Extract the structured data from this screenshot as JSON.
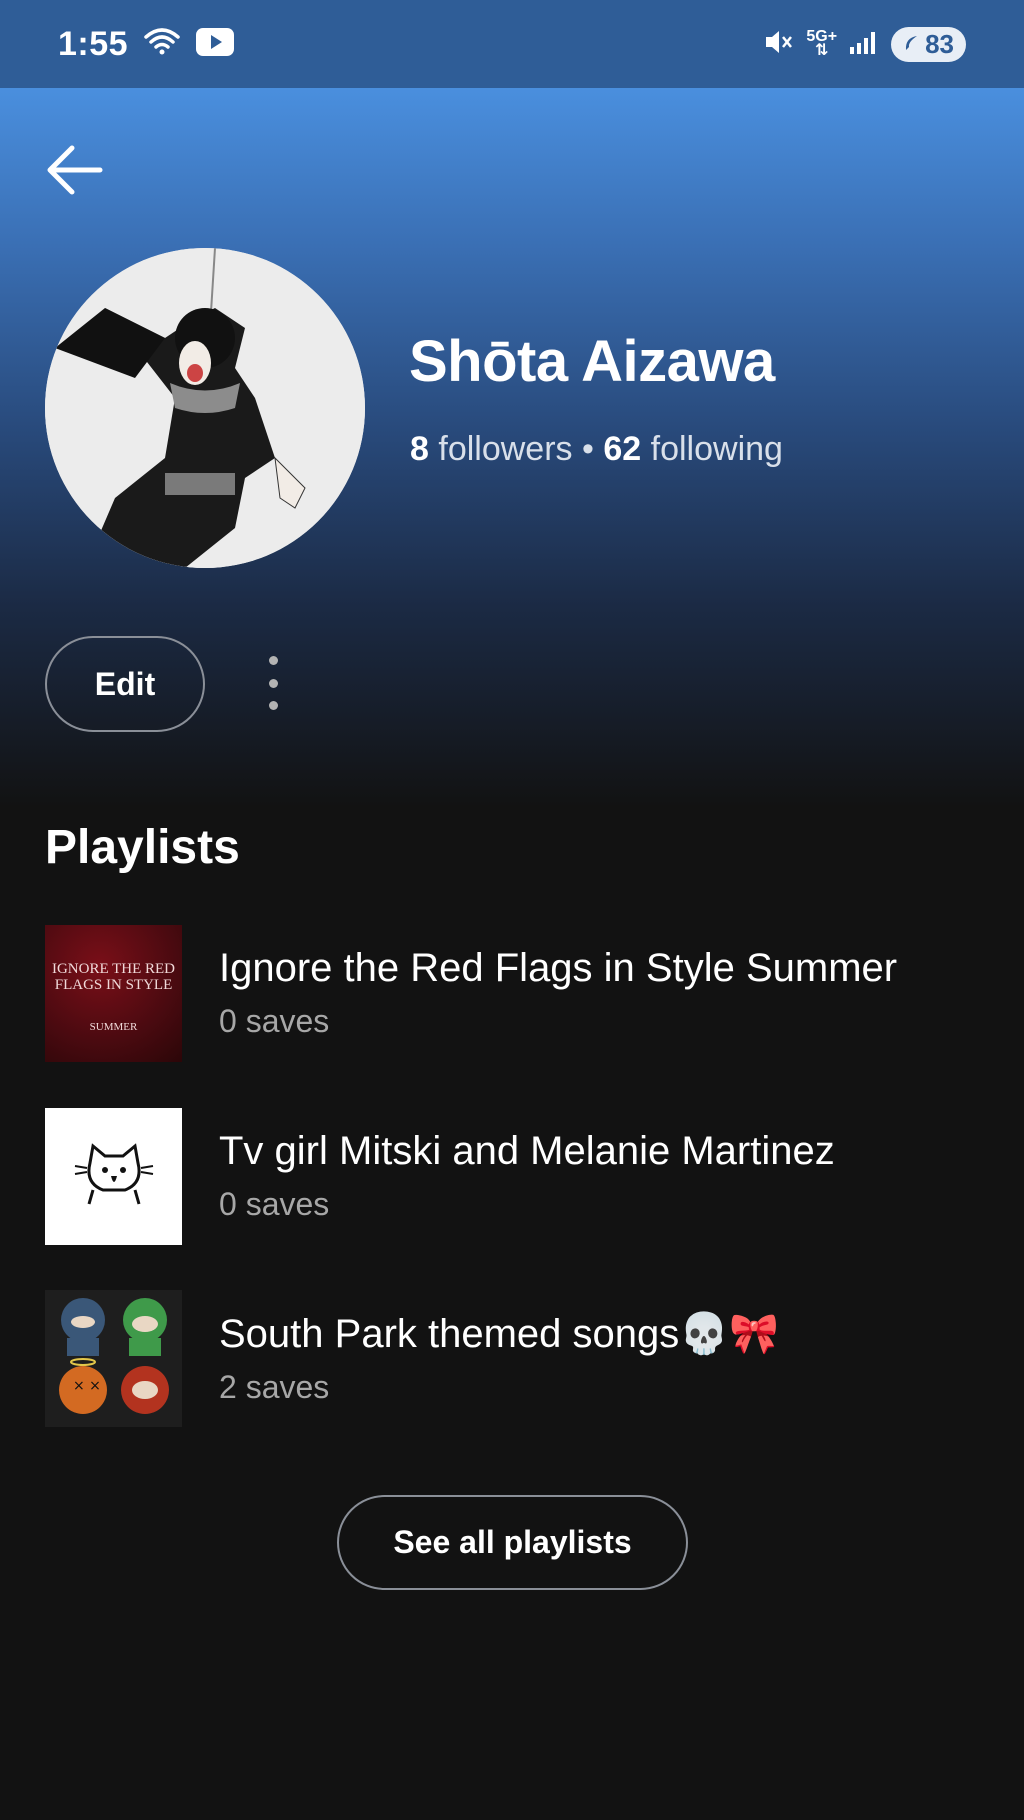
{
  "status_bar": {
    "time": "1:55",
    "network": "5G",
    "network_plus": "+",
    "battery": "83",
    "icons": [
      "wifi-icon",
      "youtube-icon",
      "mute-icon",
      "network-5g-icon",
      "signal-icon",
      "battery-icon"
    ]
  },
  "header": {
    "back_icon": "arrow-left-icon"
  },
  "profile": {
    "name": "Shōta Aizawa",
    "followers_count": "8",
    "followers_label": "followers",
    "separator": "•",
    "following_count": "62",
    "following_label": "following",
    "edit_label": "Edit",
    "more_icon": "more-vertical-icon"
  },
  "playlists_section": {
    "title": "Playlists",
    "items": [
      {
        "title": "Ignore the Red Flags in Style Summer",
        "subtitle": "0 saves",
        "cover_text_main": "IGNORE THE RED FLAGS IN STYLE",
        "cover_text_sub": "SUMMER"
      },
      {
        "title": "Tv girl Mitski and Melanie Martinez",
        "subtitle": "0 saves"
      },
      {
        "title": "South Park themed songs💀🎀",
        "subtitle": "2 saves"
      }
    ],
    "see_all_label": "See all playlists"
  },
  "colors": {
    "header_gradient_top": "#4a8fde",
    "background": "#121212",
    "status_bar": "#2f5d97",
    "secondary_text": "#a7a7a7"
  }
}
